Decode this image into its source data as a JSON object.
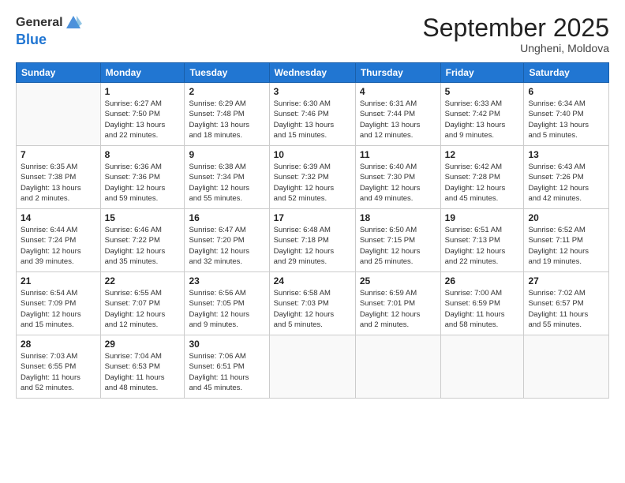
{
  "logo": {
    "general": "General",
    "blue": "Blue"
  },
  "title": "September 2025",
  "location": "Ungheni, Moldova",
  "headers": [
    "Sunday",
    "Monday",
    "Tuesday",
    "Wednesday",
    "Thursday",
    "Friday",
    "Saturday"
  ],
  "weeks": [
    [
      {
        "day": "",
        "info": ""
      },
      {
        "day": "1",
        "info": "Sunrise: 6:27 AM\nSunset: 7:50 PM\nDaylight: 13 hours\nand 22 minutes."
      },
      {
        "day": "2",
        "info": "Sunrise: 6:29 AM\nSunset: 7:48 PM\nDaylight: 13 hours\nand 18 minutes."
      },
      {
        "day": "3",
        "info": "Sunrise: 6:30 AM\nSunset: 7:46 PM\nDaylight: 13 hours\nand 15 minutes."
      },
      {
        "day": "4",
        "info": "Sunrise: 6:31 AM\nSunset: 7:44 PM\nDaylight: 13 hours\nand 12 minutes."
      },
      {
        "day": "5",
        "info": "Sunrise: 6:33 AM\nSunset: 7:42 PM\nDaylight: 13 hours\nand 9 minutes."
      },
      {
        "day": "6",
        "info": "Sunrise: 6:34 AM\nSunset: 7:40 PM\nDaylight: 13 hours\nand 5 minutes."
      }
    ],
    [
      {
        "day": "7",
        "info": "Sunrise: 6:35 AM\nSunset: 7:38 PM\nDaylight: 13 hours\nand 2 minutes."
      },
      {
        "day": "8",
        "info": "Sunrise: 6:36 AM\nSunset: 7:36 PM\nDaylight: 12 hours\nand 59 minutes."
      },
      {
        "day": "9",
        "info": "Sunrise: 6:38 AM\nSunset: 7:34 PM\nDaylight: 12 hours\nand 55 minutes."
      },
      {
        "day": "10",
        "info": "Sunrise: 6:39 AM\nSunset: 7:32 PM\nDaylight: 12 hours\nand 52 minutes."
      },
      {
        "day": "11",
        "info": "Sunrise: 6:40 AM\nSunset: 7:30 PM\nDaylight: 12 hours\nand 49 minutes."
      },
      {
        "day": "12",
        "info": "Sunrise: 6:42 AM\nSunset: 7:28 PM\nDaylight: 12 hours\nand 45 minutes."
      },
      {
        "day": "13",
        "info": "Sunrise: 6:43 AM\nSunset: 7:26 PM\nDaylight: 12 hours\nand 42 minutes."
      }
    ],
    [
      {
        "day": "14",
        "info": "Sunrise: 6:44 AM\nSunset: 7:24 PM\nDaylight: 12 hours\nand 39 minutes."
      },
      {
        "day": "15",
        "info": "Sunrise: 6:46 AM\nSunset: 7:22 PM\nDaylight: 12 hours\nand 35 minutes."
      },
      {
        "day": "16",
        "info": "Sunrise: 6:47 AM\nSunset: 7:20 PM\nDaylight: 12 hours\nand 32 minutes."
      },
      {
        "day": "17",
        "info": "Sunrise: 6:48 AM\nSunset: 7:18 PM\nDaylight: 12 hours\nand 29 minutes."
      },
      {
        "day": "18",
        "info": "Sunrise: 6:50 AM\nSunset: 7:15 PM\nDaylight: 12 hours\nand 25 minutes."
      },
      {
        "day": "19",
        "info": "Sunrise: 6:51 AM\nSunset: 7:13 PM\nDaylight: 12 hours\nand 22 minutes."
      },
      {
        "day": "20",
        "info": "Sunrise: 6:52 AM\nSunset: 7:11 PM\nDaylight: 12 hours\nand 19 minutes."
      }
    ],
    [
      {
        "day": "21",
        "info": "Sunrise: 6:54 AM\nSunset: 7:09 PM\nDaylight: 12 hours\nand 15 minutes."
      },
      {
        "day": "22",
        "info": "Sunrise: 6:55 AM\nSunset: 7:07 PM\nDaylight: 12 hours\nand 12 minutes."
      },
      {
        "day": "23",
        "info": "Sunrise: 6:56 AM\nSunset: 7:05 PM\nDaylight: 12 hours\nand 9 minutes."
      },
      {
        "day": "24",
        "info": "Sunrise: 6:58 AM\nSunset: 7:03 PM\nDaylight: 12 hours\nand 5 minutes."
      },
      {
        "day": "25",
        "info": "Sunrise: 6:59 AM\nSunset: 7:01 PM\nDaylight: 12 hours\nand 2 minutes."
      },
      {
        "day": "26",
        "info": "Sunrise: 7:00 AM\nSunset: 6:59 PM\nDaylight: 11 hours\nand 58 minutes."
      },
      {
        "day": "27",
        "info": "Sunrise: 7:02 AM\nSunset: 6:57 PM\nDaylight: 11 hours\nand 55 minutes."
      }
    ],
    [
      {
        "day": "28",
        "info": "Sunrise: 7:03 AM\nSunset: 6:55 PM\nDaylight: 11 hours\nand 52 minutes."
      },
      {
        "day": "29",
        "info": "Sunrise: 7:04 AM\nSunset: 6:53 PM\nDaylight: 11 hours\nand 48 minutes."
      },
      {
        "day": "30",
        "info": "Sunrise: 7:06 AM\nSunset: 6:51 PM\nDaylight: 11 hours\nand 45 minutes."
      },
      {
        "day": "",
        "info": ""
      },
      {
        "day": "",
        "info": ""
      },
      {
        "day": "",
        "info": ""
      },
      {
        "day": "",
        "info": ""
      }
    ]
  ]
}
